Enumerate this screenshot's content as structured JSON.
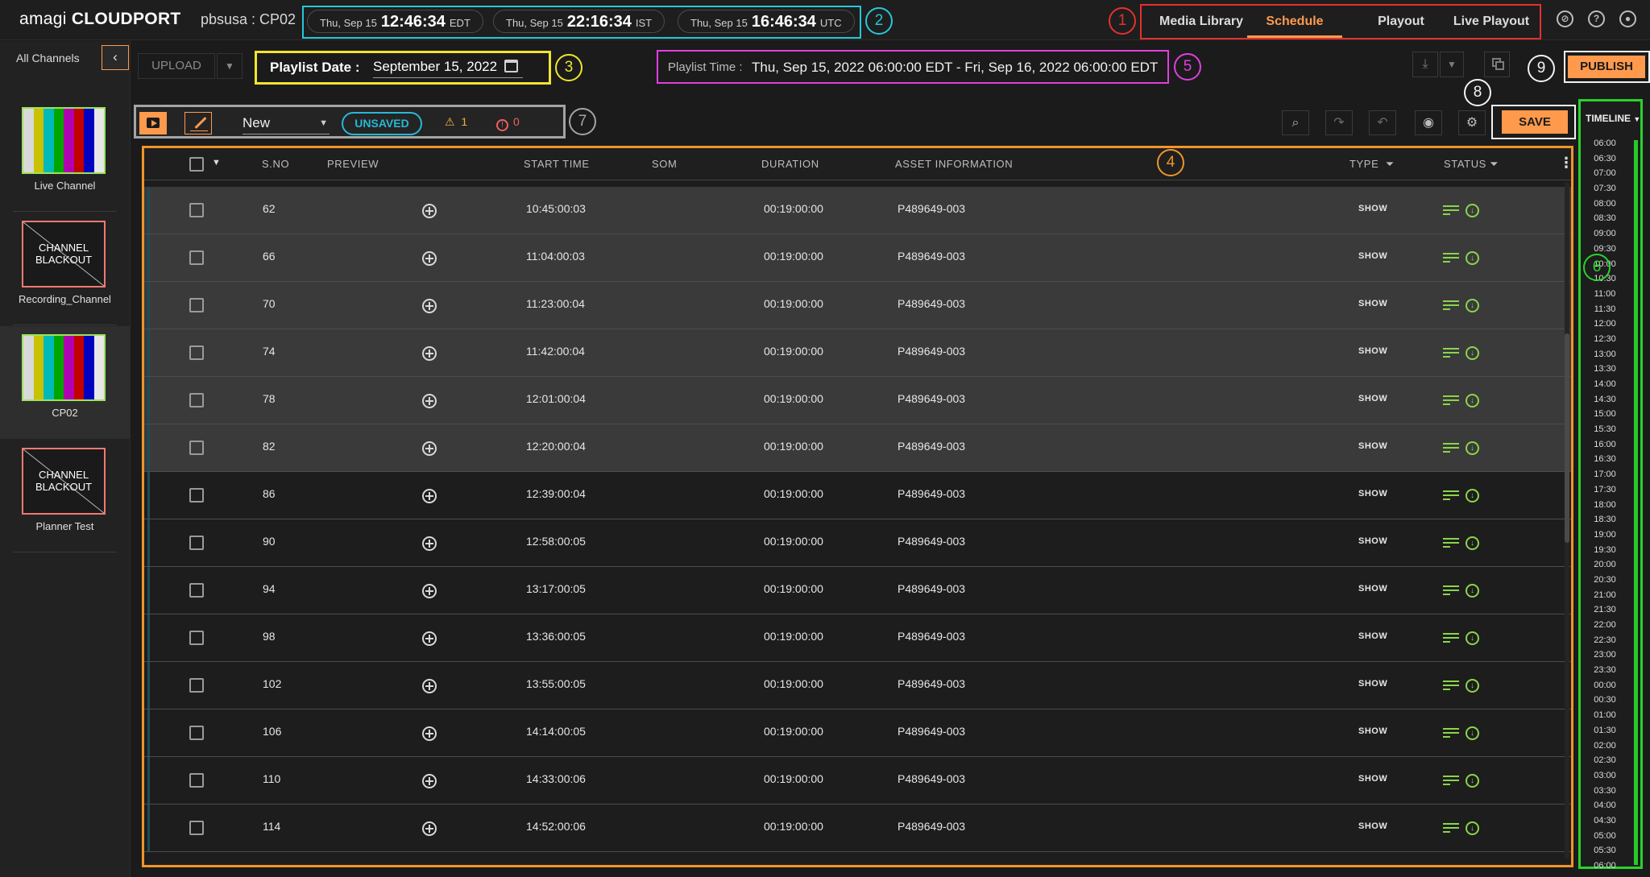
{
  "app": {
    "logo_main": "amagi",
    "logo_sub": "CLOUDPORT",
    "channel_title": "pbsusa : CP02"
  },
  "clocks": [
    {
      "date": "Thu, Sep 15",
      "time": "12:46:34",
      "zone": "EDT"
    },
    {
      "date": "Thu, Sep 15",
      "time": "22:16:34",
      "zone": "IST"
    },
    {
      "date": "Thu, Sep 15",
      "time": "16:46:34",
      "zone": "UTC"
    }
  ],
  "nav": {
    "tabs": [
      "Media Library",
      "Schedule",
      "Playout",
      "Live Playout"
    ],
    "active": "Schedule"
  },
  "top_icons": [
    "notifications-off-icon",
    "help-icon",
    "account-icon"
  ],
  "sidebar": {
    "title": "All Channels",
    "collapse_glyph": "‹",
    "channels": [
      {
        "name": "Live Channel",
        "thumb": "colorbars"
      },
      {
        "name": "Recording_Channel",
        "thumb": "blackout"
      },
      {
        "name": "CP02",
        "thumb": "colorbars",
        "selected": true
      },
      {
        "name": "Planner Test",
        "thumb": "blackout"
      }
    ],
    "blackout_line1": "CHANNEL",
    "blackout_line2": "BLACKOUT"
  },
  "toolbar": {
    "upload_label": "UPLOAD",
    "playlist_date_label": "Playlist Date :",
    "playlist_date_value": "September 15, 2022",
    "playlist_time_label": "Playlist Time :",
    "playlist_time_value": "Thu, Sep 15, 2022 06:00:00 EDT - Fri, Sep 16, 2022 06:00:00 EDT",
    "publish_label": "PUBLISH",
    "save_label": "SAVE",
    "playlist_select_value": "New",
    "unsaved_label": "UNSAVED",
    "warning_count": "1",
    "error_count": "0"
  },
  "markers": [
    "1",
    "2",
    "3",
    "4",
    "5",
    "6",
    "7",
    "8",
    "9"
  ],
  "colors": {
    "accent": "#ff9a4d",
    "status_green": "#8bd44a",
    "unsaved_blue": "#27b8d6"
  },
  "table": {
    "headers": {
      "sno": "S.NO",
      "preview": "PREVIEW",
      "start": "START TIME",
      "som": "SOM",
      "duration": "DURATION",
      "asset": "ASSET INFORMATION",
      "type": "TYPE",
      "status": "STATUS"
    },
    "rows": [
      {
        "sno": "62",
        "start": "10:45:00:03",
        "duration": "00:19:00:00",
        "asset": "P489649-003",
        "type": "SHOW",
        "shaded": true
      },
      {
        "sno": "66",
        "start": "11:04:00:03",
        "duration": "00:19:00:00",
        "asset": "P489649-003",
        "type": "SHOW",
        "shaded": true
      },
      {
        "sno": "70",
        "start": "11:23:00:04",
        "duration": "00:19:00:00",
        "asset": "P489649-003",
        "type": "SHOW",
        "shaded": true
      },
      {
        "sno": "74",
        "start": "11:42:00:04",
        "duration": "00:19:00:00",
        "asset": "P489649-003",
        "type": "SHOW",
        "shaded": true
      },
      {
        "sno": "78",
        "start": "12:01:00:04",
        "duration": "00:19:00:00",
        "asset": "P489649-003",
        "type": "SHOW",
        "shaded": true
      },
      {
        "sno": "82",
        "start": "12:20:00:04",
        "duration": "00:19:00:00",
        "asset": "P489649-003",
        "type": "SHOW",
        "shaded": true
      },
      {
        "sno": "86",
        "start": "12:39:00:04",
        "duration": "00:19:00:00",
        "asset": "P489649-003",
        "type": "SHOW",
        "shaded": false
      },
      {
        "sno": "90",
        "start": "12:58:00:05",
        "duration": "00:19:00:00",
        "asset": "P489649-003",
        "type": "SHOW",
        "shaded": false
      },
      {
        "sno": "94",
        "start": "13:17:00:05",
        "duration": "00:19:00:00",
        "asset": "P489649-003",
        "type": "SHOW",
        "shaded": false
      },
      {
        "sno": "98",
        "start": "13:36:00:05",
        "duration": "00:19:00:00",
        "asset": "P489649-003",
        "type": "SHOW",
        "shaded": false
      },
      {
        "sno": "102",
        "start": "13:55:00:05",
        "duration": "00:19:00:00",
        "asset": "P489649-003",
        "type": "SHOW",
        "shaded": false
      },
      {
        "sno": "106",
        "start": "14:14:00:05",
        "duration": "00:19:00:00",
        "asset": "P489649-003",
        "type": "SHOW",
        "shaded": false
      },
      {
        "sno": "110",
        "start": "14:33:00:06",
        "duration": "00:19:00:00",
        "asset": "P489649-003",
        "type": "SHOW",
        "shaded": false
      },
      {
        "sno": "114",
        "start": "14:52:00:06",
        "duration": "00:19:00:00",
        "asset": "P489649-003",
        "type": "SHOW",
        "shaded": false
      }
    ]
  },
  "timeline": {
    "title": "TIMELINE",
    "times": [
      "06:00",
      "06:30",
      "07:00",
      "07:30",
      "08:00",
      "08:30",
      "09:00",
      "09:30",
      "10:00",
      "10:30",
      "11:00",
      "11:30",
      "12:00",
      "12:30",
      "13:00",
      "13:30",
      "14:00",
      "14:30",
      "15:00",
      "15:30",
      "16:00",
      "16:30",
      "17:00",
      "17:30",
      "18:00",
      "18:30",
      "19:00",
      "19:30",
      "20:00",
      "20:30",
      "21:00",
      "21:30",
      "22:00",
      "22:30",
      "23:00",
      "23:30",
      "00:00",
      "00:30",
      "01:00",
      "01:30",
      "02:00",
      "02:30",
      "03:00",
      "03:30",
      "04:00",
      "04:30",
      "05:00",
      "05:30",
      "06:00"
    ]
  }
}
